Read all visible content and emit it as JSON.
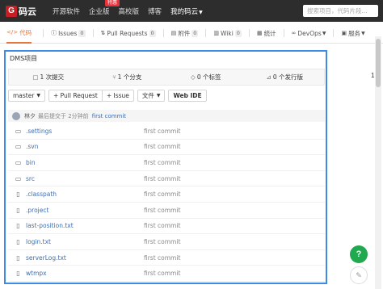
{
  "nav": {
    "logo_mark": "G",
    "logo_text": "码云",
    "links": [
      "开源软件",
      "企业版",
      "高校版",
      "博客"
    ],
    "enterprise_badge": "特惠",
    "my": "我的码云",
    "search_placeholder": "搜索项目，代码片段..."
  },
  "tabs": [
    {
      "label": "代码",
      "icon": "code-icon",
      "active": true
    },
    {
      "label": "Issues",
      "count": "0",
      "icon": "issue-icon"
    },
    {
      "label": "Pull Requests",
      "count": "0",
      "icon": "pull-request-icon"
    },
    {
      "label": "附件",
      "count": "0",
      "icon": "attachment-icon"
    },
    {
      "label": "Wiki",
      "count": "0",
      "icon": "wiki-icon"
    },
    {
      "label": "统计",
      "icon": "stats-icon"
    },
    {
      "label": "DevOps",
      "icon": "devops-icon"
    },
    {
      "label": "服务",
      "icon": "service-icon"
    }
  ],
  "project": {
    "title": "DMS项目",
    "stats": [
      {
        "label": "1 次提交",
        "icon": "commit-icon"
      },
      {
        "label": "1 个分支",
        "icon": "branch-icon"
      },
      {
        "label": "0 个标签",
        "icon": "tag-icon"
      },
      {
        "label": "0 个发行版",
        "icon": "release-icon"
      }
    ],
    "side_peek": "1",
    "toolbar": {
      "branch": "master",
      "pull_request": "+ Pull Request",
      "issue": "+ Issue",
      "file": "文件",
      "web_ide": "Web IDE"
    },
    "last_commit": {
      "author": "林夕",
      "meta": "最后提交于 2分钟前",
      "message": "first commit"
    },
    "files": [
      {
        "name": ".settings",
        "type": "folder",
        "commit": "first commit"
      },
      {
        "name": ".svn",
        "type": "folder",
        "commit": "first commit"
      },
      {
        "name": "bin",
        "type": "folder",
        "commit": "first commit"
      },
      {
        "name": "src",
        "type": "folder",
        "commit": "first commit"
      },
      {
        "name": ".classpath",
        "type": "file",
        "commit": "first commit"
      },
      {
        "name": ".project",
        "type": "file",
        "commit": "first commit"
      },
      {
        "name": "last-position.txt",
        "type": "file",
        "commit": "first commit"
      },
      {
        "name": "login.txt",
        "type": "file",
        "commit": "first commit"
      },
      {
        "name": "serverLog.txt",
        "type": "file",
        "commit": "first commit"
      },
      {
        "name": "wtmpx",
        "type": "file",
        "commit": "first commit"
      }
    ]
  },
  "float": {
    "help": "?",
    "feedback_icon": "edit-icon"
  },
  "colors": {
    "accent": "#e6773b",
    "link": "#3c6fb4",
    "highlight_border": "#3c8ce7",
    "help": "#21a94f",
    "brand": "#c71d23"
  }
}
